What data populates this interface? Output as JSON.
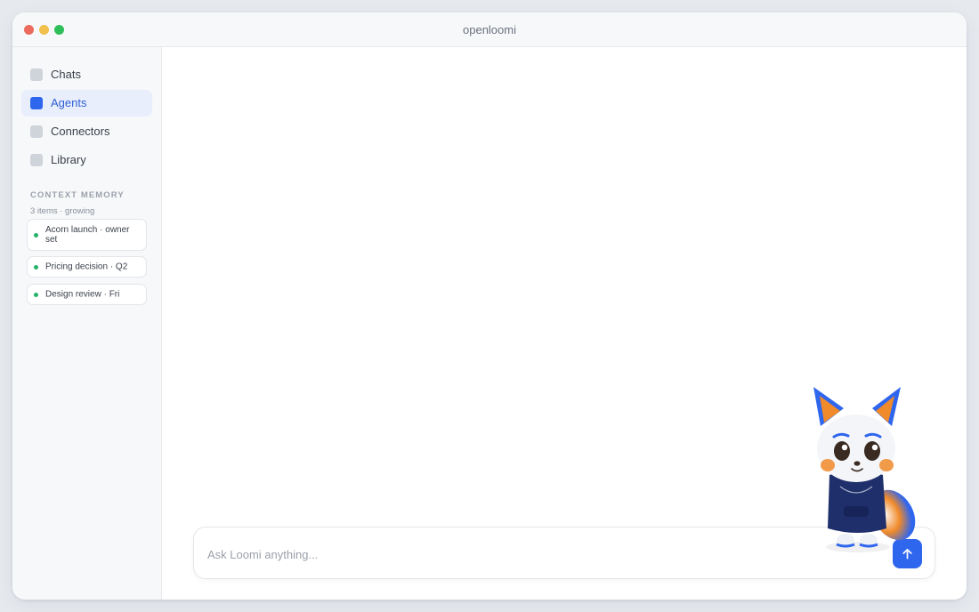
{
  "window": {
    "title": "openloomi"
  },
  "sidebar": {
    "items": [
      {
        "label": "Chats",
        "icon": "chats-icon",
        "active": false
      },
      {
        "label": "Agents",
        "icon": "agents-icon",
        "active": true
      },
      {
        "label": "Connectors",
        "icon": "connectors-icon",
        "active": false
      },
      {
        "label": "Library",
        "icon": "library-icon",
        "active": false
      }
    ],
    "context_memory": {
      "title": "CONTEXT MEMORY",
      "subtitle": "3 items · growing",
      "items": [
        {
          "label": "Acorn launch · owner set",
          "status_color": "#24b36b"
        },
        {
          "label": "Pricing decision · Q2",
          "status_color": "#24b36b"
        },
        {
          "label": "Design review · Fri",
          "status_color": "#24b36b"
        }
      ]
    }
  },
  "composer": {
    "placeholder": "Ask Loomi anything...",
    "value": "",
    "send_icon": "arrow-up-icon"
  },
  "colors": {
    "accent": "#2f66ee",
    "status_green": "#24b36b",
    "window_bg": "#e6e9ee"
  }
}
